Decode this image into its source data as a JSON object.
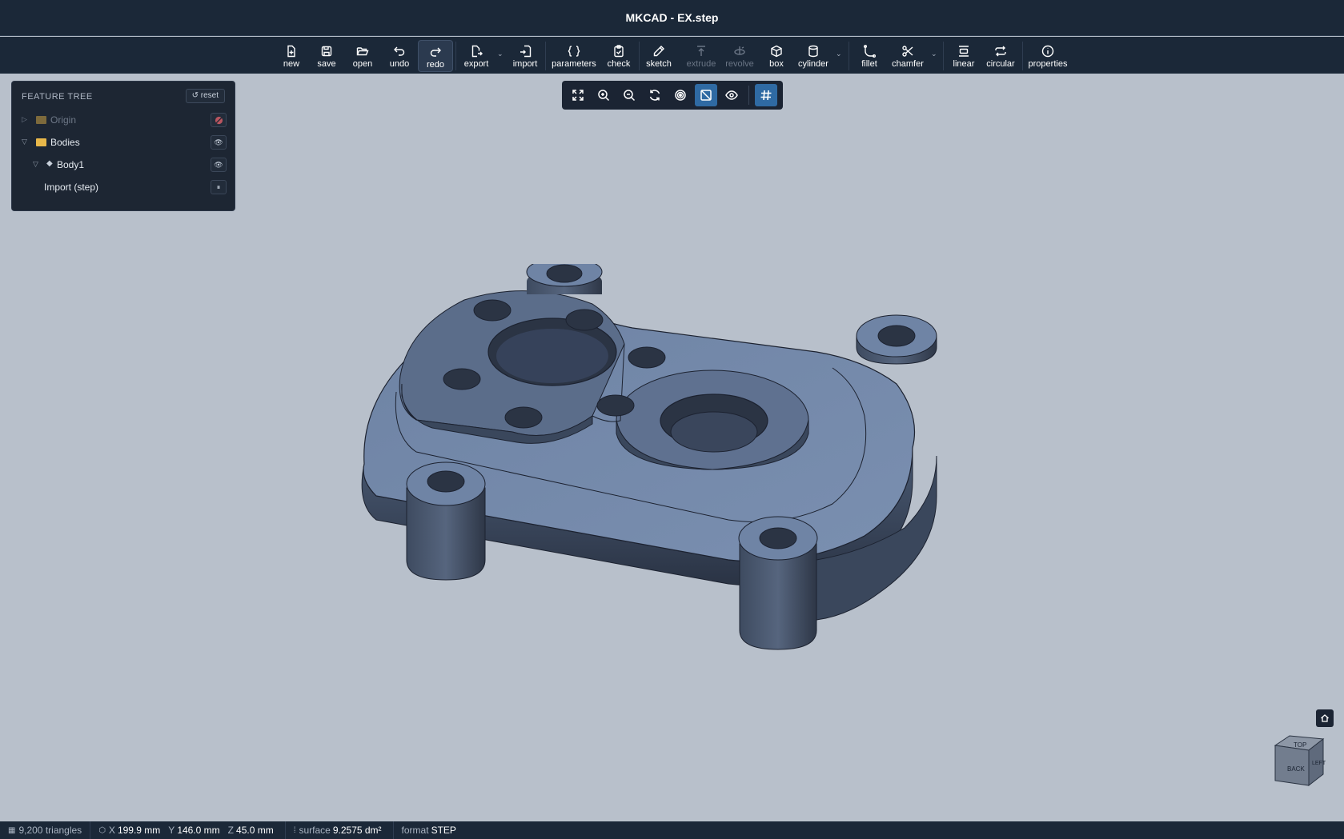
{
  "window": {
    "title": "MKCAD - EX.step"
  },
  "toolbar": {
    "new": "new",
    "save": "save",
    "open": "open",
    "undo": "undo",
    "redo": "redo",
    "export": "export",
    "import": "import",
    "parameters": "parameters",
    "check": "check",
    "sketch": "sketch",
    "extrude": "extrude",
    "revolve": "revolve",
    "box": "box",
    "cylinder": "cylinder",
    "fillet": "fillet",
    "chamfer": "chamfer",
    "linear": "linear",
    "circular": "circular",
    "properties": "properties"
  },
  "feature_tree": {
    "header": "FEATURE TREE",
    "reset": "↺ reset",
    "items": [
      {
        "label": "Origin",
        "visible": false
      },
      {
        "label": "Bodies",
        "visible": true
      },
      {
        "label": "Body1",
        "visible": true
      },
      {
        "label": "Import (step)",
        "paused": true
      }
    ]
  },
  "view_cube": {
    "top": "TOP",
    "front": "BACK",
    "side": "LEFT"
  },
  "status": {
    "triangles": "9,200 triangles",
    "x_label": "X",
    "x_value": "199.9 mm",
    "y_label": "Y",
    "y_value": "146.0 mm",
    "z_label": "Z",
    "z_value": "45.0 mm",
    "surface_label": "surface",
    "surface_value": "9.2575 dm²",
    "format_label": "format",
    "format_value": "STEP"
  },
  "colors": {
    "chrome": "#1b2838",
    "viewport": "#b8c0cb",
    "accent": "#2f6aa3",
    "model": "#7288a8"
  }
}
